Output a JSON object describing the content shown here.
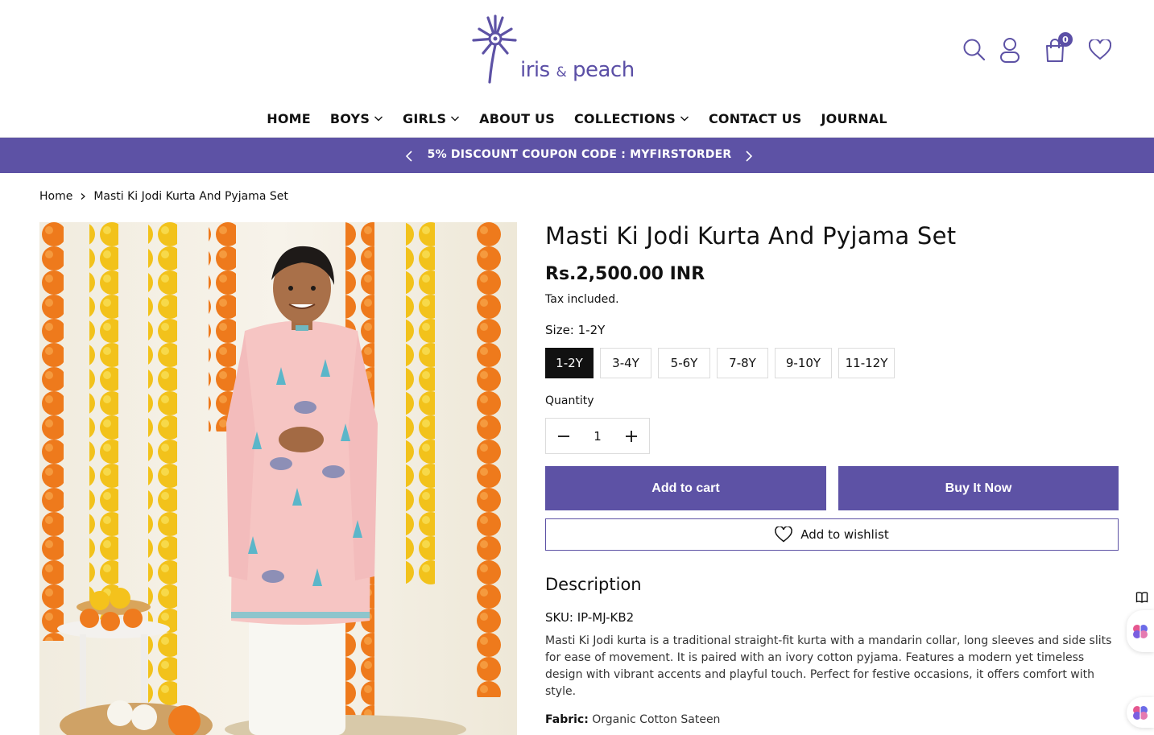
{
  "brand": {
    "logo_name": "iris",
    "logo_amp": "&",
    "logo_suffix": "peach",
    "accent_color": "#5d52a5"
  },
  "header": {
    "icons": [
      "search-icon",
      "account-icon",
      "cart-icon",
      "wishlist-icon"
    ],
    "cart_count": "0"
  },
  "nav": {
    "items": [
      {
        "label": "HOME",
        "dropdown": false
      },
      {
        "label": "BOYS",
        "dropdown": true
      },
      {
        "label": "GIRLS",
        "dropdown": true
      },
      {
        "label": "ABOUT US",
        "dropdown": false
      },
      {
        "label": "COLLECTIONS",
        "dropdown": true
      },
      {
        "label": "CONTACT US",
        "dropdown": false
      },
      {
        "label": "JOURNAL",
        "dropdown": false
      }
    ]
  },
  "announcement": {
    "text": "5% DISCOUNT COUPON CODE : MYFIRSTORDER"
  },
  "breadcrumb": {
    "home": "Home",
    "current": "Masti Ki Jodi Kurta And Pyjama Set"
  },
  "product": {
    "title": "Masti Ki Jodi Kurta And Pyjama Set",
    "price": "Rs.2,500.00 INR",
    "tax_note": "Tax included.",
    "size_label": "Size: 1-2Y",
    "sizes": [
      "1-2Y",
      "3-4Y",
      "5-6Y",
      "7-8Y",
      "9-10Y",
      "11-12Y"
    ],
    "selected_size": "1-2Y",
    "quantity_label": "Quantity",
    "quantity": "1",
    "add_to_cart": "Add to cart",
    "buy_now": "Buy It Now",
    "add_to_wishlist": "Add to wishlist",
    "description_heading": "Description",
    "sku": "SKU: IP-MJ-KB2",
    "description": "Masti Ki Jodi kurta is a traditional straight-fit kurta with a mandarin collar, long sleeves and side slits for ease of movement. It is paired with an ivory cotton pyjama. Features a modern yet timeless design with vibrant accents and playful touch. Perfect for festive occasions, it offers comfort with style.",
    "fabric_label": "Fabric:",
    "fabric_value": "Organic Cotton Sateen"
  }
}
